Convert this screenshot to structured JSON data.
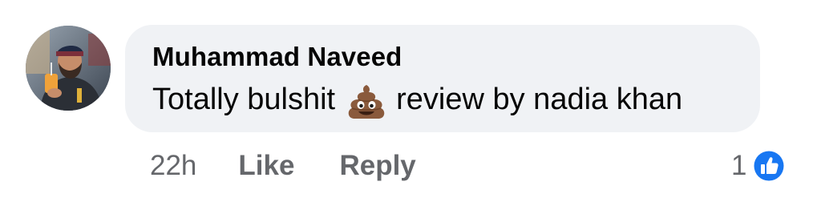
{
  "comment": {
    "author": "Muhammad Naveed",
    "text_before": "Totally bulshit",
    "emoji_icon": "pile-of-poo-emoji-icon",
    "text_after": "review by nadia khan",
    "timestamp": "22h",
    "like_label": "Like",
    "reply_label": "Reply",
    "reaction_count": "1",
    "reaction_icon": "like-reaction-icon"
  },
  "colors": {
    "bubble_background": "#f0f2f5",
    "secondary_text": "#65676b",
    "primary_text": "#050505",
    "like_blue": "#1877f2"
  }
}
